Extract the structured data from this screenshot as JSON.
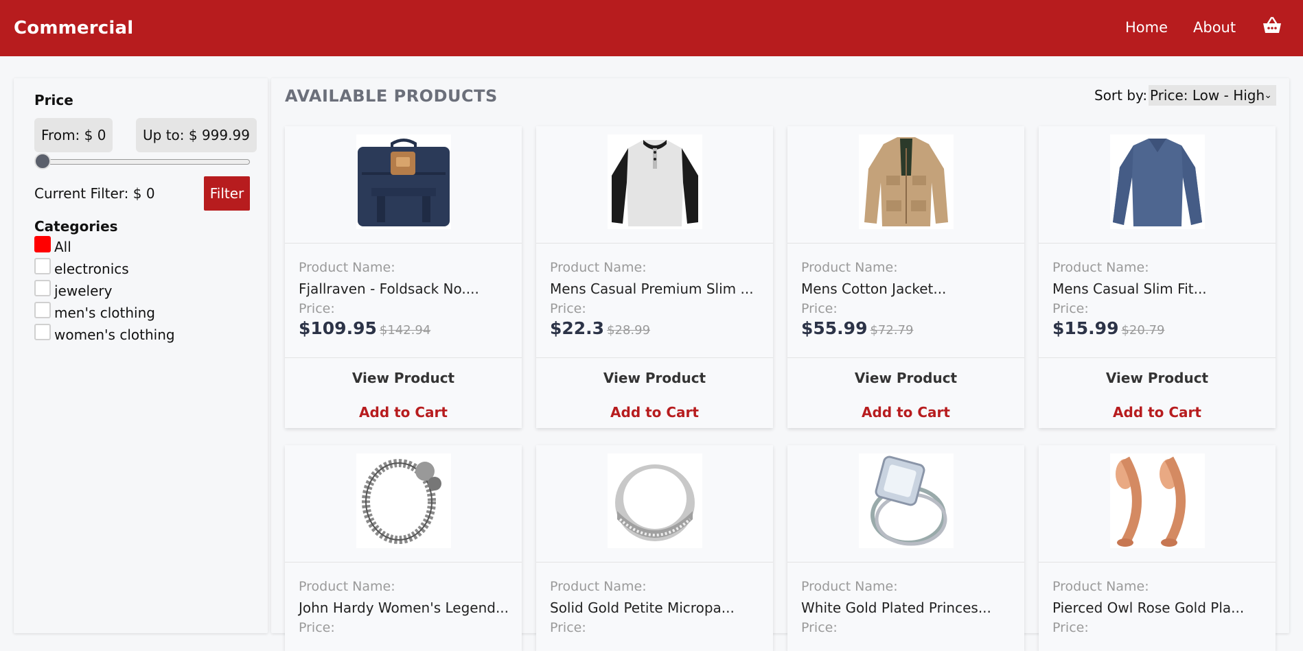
{
  "header": {
    "brand": "Commercial",
    "nav": [
      "Home",
      "About"
    ],
    "cart_icon": "shopping-basket-icon",
    "bg_color": "#b71c1e"
  },
  "sidebar": {
    "price_title": "Price",
    "from_label": "From: $ 0",
    "upto_label": "Up to: $ 999.99",
    "slider_value": 0,
    "current_filter": "Current Filter: $ 0",
    "filter_button": "Filter",
    "categories_title": "Categories",
    "categories": [
      {
        "label": "All",
        "checked": true
      },
      {
        "label": "electronics",
        "checked": false
      },
      {
        "label": "jewelery",
        "checked": false
      },
      {
        "label": "men's clothing",
        "checked": false
      },
      {
        "label": "women's clothing",
        "checked": false
      }
    ]
  },
  "main": {
    "title": "AVAILABLE PRODUCTS",
    "sort_label": "Sort by:",
    "sort_value": "Price: Low - High",
    "name_label": "Product Name:",
    "price_label": "Price:",
    "view_label": "View Product",
    "add_label": "Add to Cart",
    "products": [
      {
        "name": "Fjallraven - Foldsack No....",
        "price": "$109.95",
        "old_price": "$142.94",
        "image": "backpack-image"
      },
      {
        "name": "Mens Casual Premium Slim ...",
        "price": "$22.3",
        "old_price": "$28.99",
        "image": "tshirt-image"
      },
      {
        "name": "Mens Cotton Jacket...",
        "price": "$55.99",
        "old_price": "$72.79",
        "image": "jacket-image"
      },
      {
        "name": "Mens Casual Slim Fit...",
        "price": "$15.99",
        "old_price": "$20.79",
        "image": "longsleeve-image"
      },
      {
        "name": "John Hardy Women's Legend...",
        "price": "",
        "old_price": "",
        "image": "bracelet-image"
      },
      {
        "name": "Solid Gold Petite Micropa...",
        "price": "",
        "old_price": "",
        "image": "ring-image"
      },
      {
        "name": "White Gold Plated Princes...",
        "price": "",
        "old_price": "",
        "image": "engagement-ring-image"
      },
      {
        "name": "Pierced Owl Rose Gold Pla...",
        "price": "",
        "old_price": "",
        "image": "rose-gold-plugs-image"
      }
    ]
  }
}
